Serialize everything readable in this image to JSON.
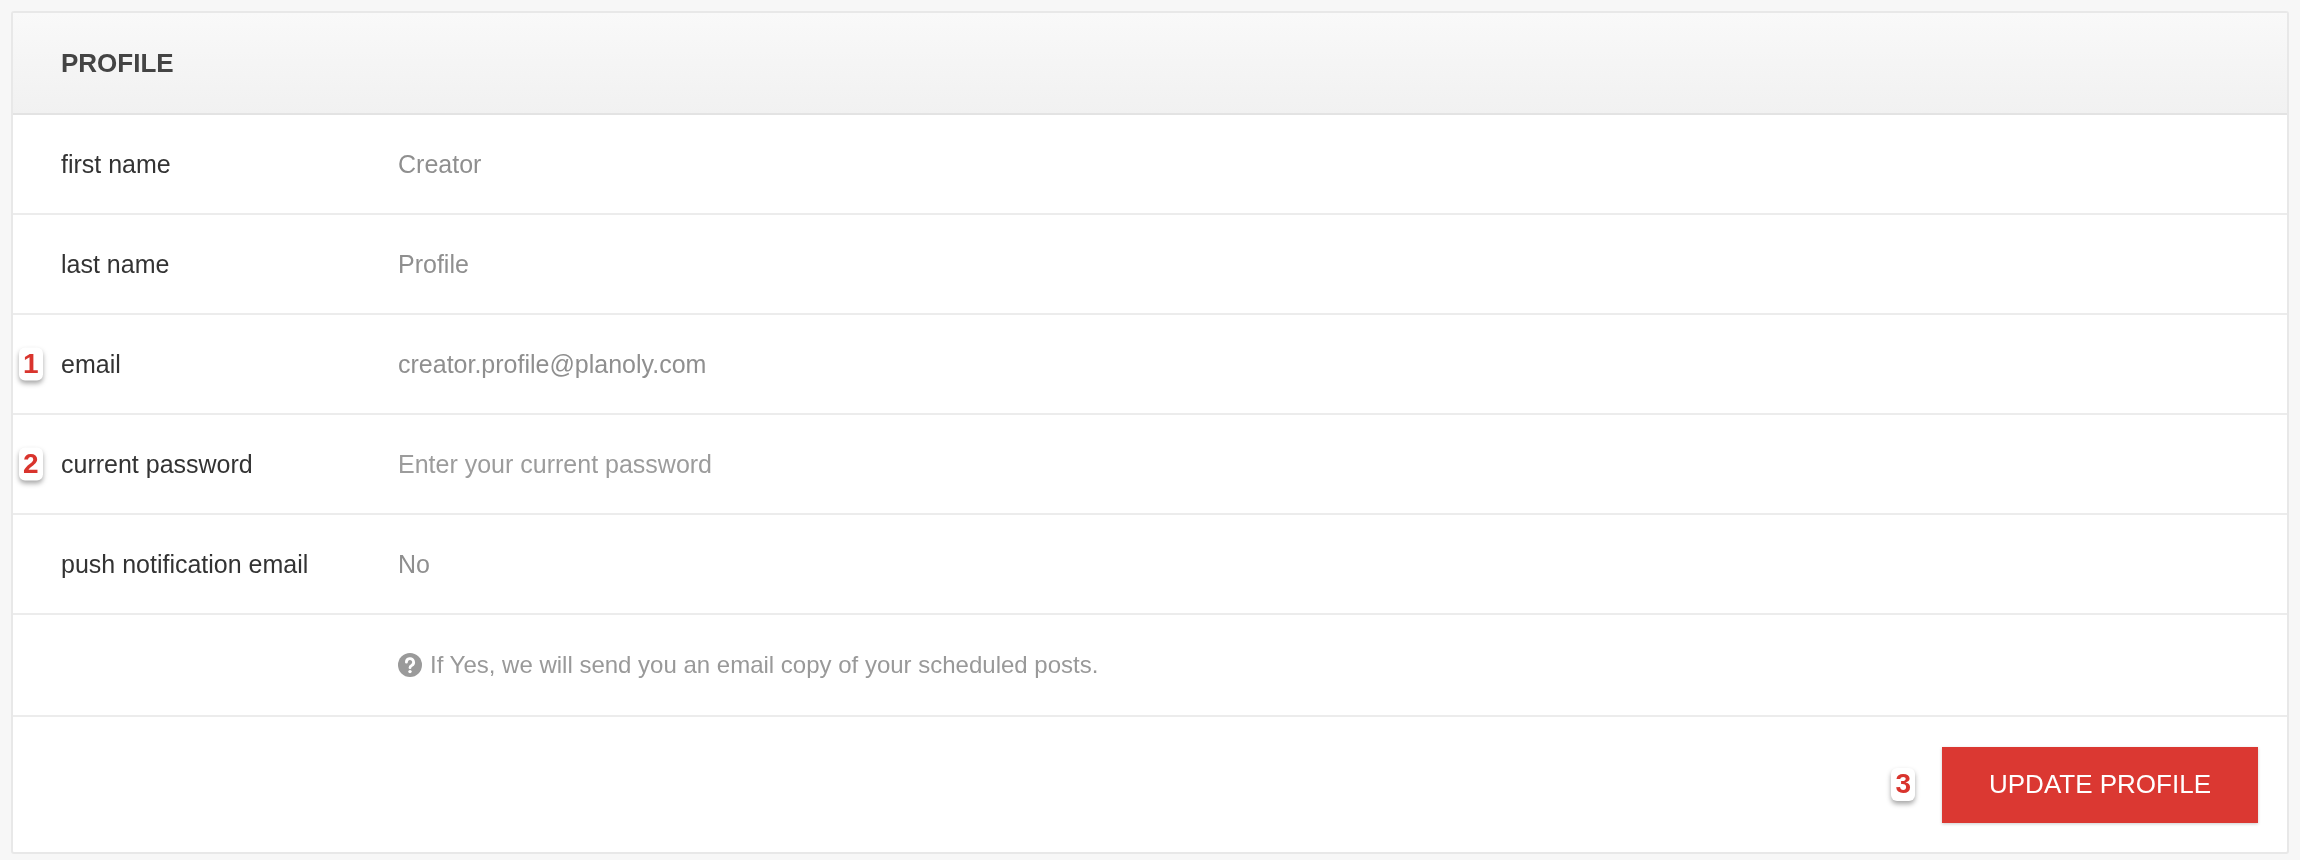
{
  "panel": {
    "title": "PROFILE"
  },
  "fields": [
    {
      "label": "first name",
      "value": "Creator"
    },
    {
      "label": "last name",
      "value": "Profile"
    },
    {
      "label": "email",
      "value": "creator.profile@planoly.com",
      "marker": "1"
    },
    {
      "label": "current password",
      "placeholder": "Enter your current password",
      "marker": "2"
    },
    {
      "label": "push notification email",
      "value": "No"
    }
  ],
  "help_text": "If Yes, we will send you an email copy of your scheduled posts.",
  "update_button": {
    "label": "UPDATE PROFILE",
    "marker": "3"
  }
}
